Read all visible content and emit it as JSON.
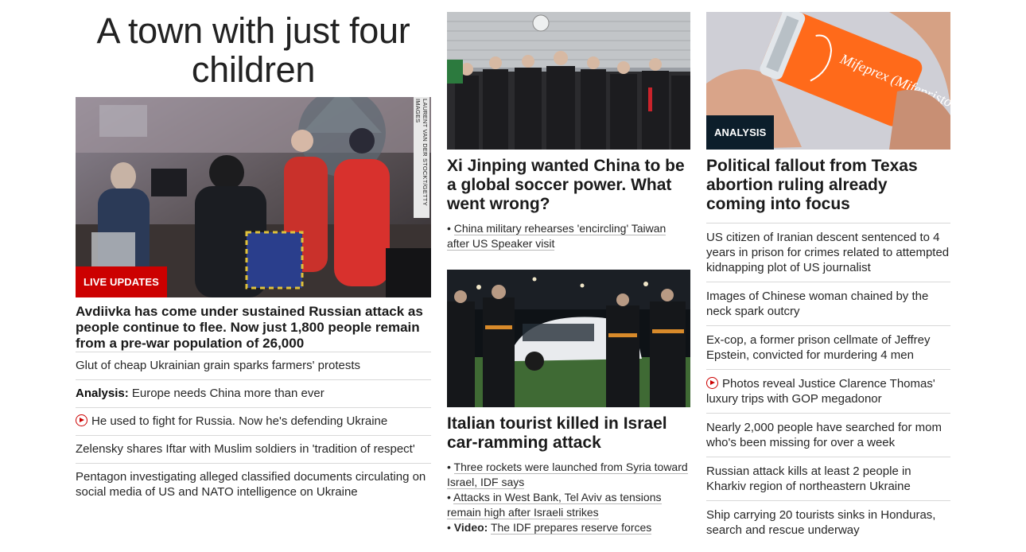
{
  "left": {
    "title": "A town with just four children",
    "image_credit": "LAURENT VAN DER STOCKT/GETTY IMAGES",
    "badge": "LIVE UPDATES",
    "headline": "Avdiivka has come under sustained Russian attack as people continue to flee. Now just 1,800 people remain from a pre-war population of 26,000",
    "items": [
      {
        "prefix": "",
        "text": "Glut of cheap Ukrainian grain sparks farmers' protests"
      },
      {
        "prefix": "Analysis:",
        "text": " Europe needs China more than ever"
      },
      {
        "prefix": "",
        "text": "He used to fight for Russia. Now he's defending Ukraine"
      },
      {
        "prefix": "",
        "text": "Zelensky shares Iftar with Muslim soldiers in 'tradition of respect'"
      },
      {
        "prefix": "",
        "text": "Pentagon investigating alleged classified documents circulating on social media of US and NATO intelligence on Ukraine"
      }
    ]
  },
  "middle": {
    "story1": {
      "headline": "Xi Jinping wanted China to be a global soccer power. What went wrong?",
      "bullets": [
        "China military rehearses 'encircling' Taiwan after US Speaker visit"
      ]
    },
    "story2": {
      "headline": "Italian tourist killed in Israel car-ramming attack",
      "bullets": [
        {
          "prefix": "",
          "text": "Three rockets were launched from Syria toward Israel, IDF says"
        },
        {
          "prefix": "",
          "text": "Attacks in West Bank, Tel Aviv as tensions remain high after Israeli strikes"
        },
        {
          "prefix": "Video:",
          "text": "The IDF prepares reserve forces"
        }
      ]
    }
  },
  "right": {
    "badge": "ANALYSIS",
    "image_label": "Mifeprex (Mifepristone)",
    "headline": "Political fallout from Texas abortion ruling already coming into focus",
    "items": [
      "US citizen of Iranian descent sentenced to 4 years in prison for crimes related to attempted kidnapping plot of US journalist",
      "Images of Chinese woman chained by the neck spark outcry",
      "Ex-cop, a former prison cellmate of Jeffrey Epstein, convicted for murdering 4 men",
      "Photos reveal Justice Clarence Thomas' luxury trips with GOP megadonor",
      "Nearly 2,000 people have searched for mom who's been missing for over a week",
      "Russian attack kills at least 2 people in Kharkiv region of northeastern Ukraine",
      "Ship carrying 20 tourists sinks in Honduras, search and rescue underway"
    ]
  },
  "colors": {
    "live_red": "#cc0000",
    "analysis_navy": "#0c1e2b",
    "divider": "#d8d8d8"
  }
}
